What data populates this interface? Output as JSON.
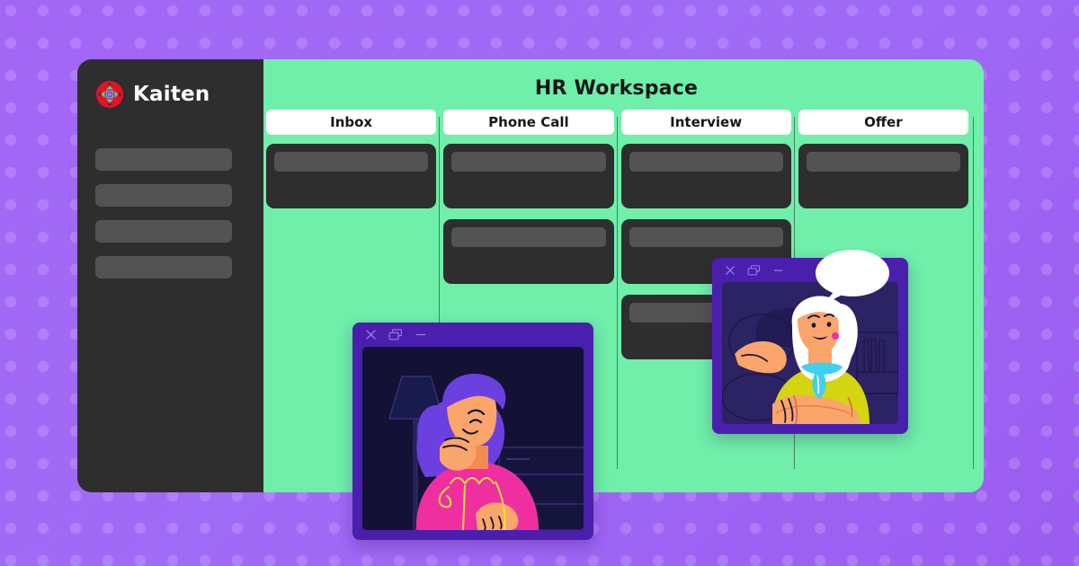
{
  "brand": {
    "name": "Kaiten",
    "logo_icon": "kaiten-diamond-logo-icon",
    "logo_colors": {
      "outer": "#e8102a",
      "mid": "#3fd98a",
      "inner": "#8b3df0"
    }
  },
  "theme": {
    "background_purple": "#a366f5",
    "board_green": "#6fefa9",
    "sidebar_dark": "#2e2e2e",
    "card_dark": "#2e2e2e",
    "card_bar_gray": "#535353",
    "window_chrome_purple": "#4b1fae",
    "column_divider": "#3a5c4a"
  },
  "sidebar": {
    "nav_placeholders": [
      {
        "label": ""
      },
      {
        "label": ""
      },
      {
        "label": ""
      },
      {
        "label": ""
      }
    ]
  },
  "board": {
    "title": "HR Workspace",
    "columns": [
      {
        "title": "Inbox",
        "cards": [
          {
            "bar": "full"
          }
        ]
      },
      {
        "title": "Phone Call",
        "cards": [
          {
            "bar": "full"
          },
          {
            "bar": "full"
          }
        ]
      },
      {
        "title": "Interview",
        "cards": [
          {
            "bar": "full"
          },
          {
            "bar": "full"
          },
          {
            "bar": "short"
          }
        ]
      },
      {
        "title": "Offer",
        "cards": [
          {
            "bar": "full"
          }
        ]
      }
    ]
  },
  "video_windows": [
    {
      "id": "video-call-window-1",
      "controls": [
        {
          "name": "close-icon",
          "glyph": "×"
        },
        {
          "name": "restore-windows-icon",
          "glyph": "❐"
        },
        {
          "name": "minimize-icon",
          "glyph": "—"
        }
      ],
      "content": "illustration-woman-purple-hair-pink-sweater"
    },
    {
      "id": "video-call-window-2",
      "controls": [
        {
          "name": "close-icon",
          "glyph": "×"
        },
        {
          "name": "restore-windows-icon",
          "glyph": "❐"
        },
        {
          "name": "minimize-icon",
          "glyph": "—"
        }
      ],
      "content": "illustration-woman-white-hair-yellow-shirt-speaking",
      "speech_bubble": {
        "text": ""
      }
    }
  ]
}
